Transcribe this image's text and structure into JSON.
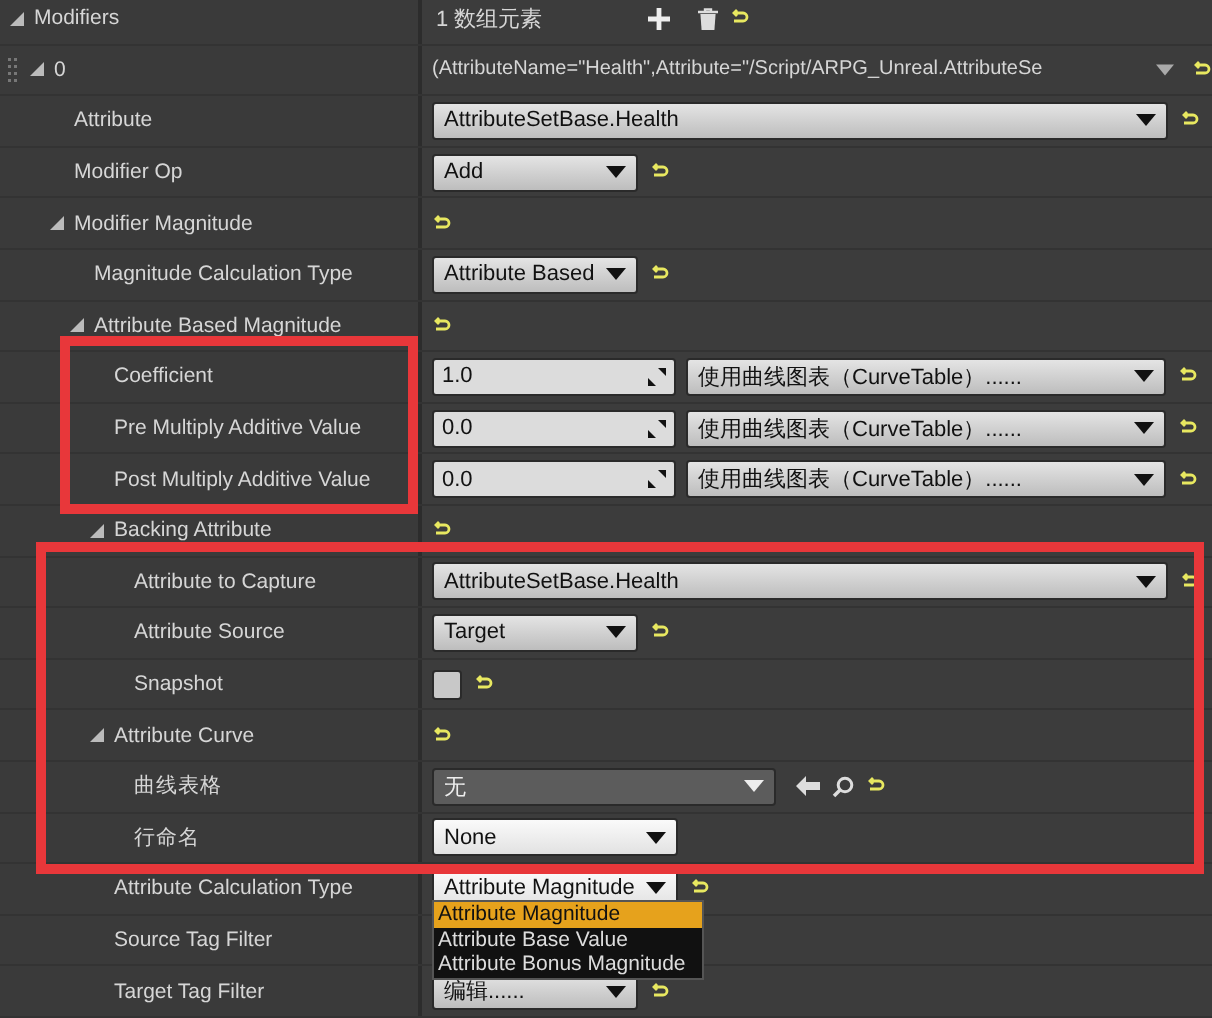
{
  "rows": [
    {
      "label": "Modifiers",
      "expanded": true,
      "reset": true,
      "value": {
        "kind": "count",
        "text": "1 数组元素"
      },
      "children": [
        {
          "label": "0",
          "expanded": true,
          "reset": true,
          "value": {
            "kind": "struct",
            "text": "(AttributeName=\"Health\",Attribute=\"/Script/ARPG_Unreal.AttributeSe"
          },
          "children": [
            {
              "label": "Attribute",
              "reset": true,
              "value": {
                "kind": "combo-wide",
                "text": "AttributeSetBase.Health"
              }
            },
            {
              "label": "Modifier Op",
              "reset": true,
              "value": {
                "kind": "combo",
                "text": "Add"
              }
            },
            {
              "label": "Modifier Magnitude",
              "expanded": true,
              "reset": true,
              "value": {
                "kind": "none"
              },
              "children": [
                {
                  "label": "Magnitude Calculation Type",
                  "reset": true,
                  "value": {
                    "kind": "combo",
                    "text": "Attribute Based"
                  }
                },
                {
                  "label": "Attribute Based Magnitude",
                  "expanded": true,
                  "reset": true,
                  "value": {
                    "kind": "none"
                  },
                  "children": [
                    {
                      "label": "Coefficient",
                      "reset": true,
                      "label_highlighted": true,
                      "value": {
                        "kind": "number-curve",
                        "text": "1.0",
                        "curve": "使用曲线图表（CurveTable）......"
                      }
                    },
                    {
                      "label": "Pre Multiply Additive Value",
                      "reset": true,
                      "label_highlighted": true,
                      "value": {
                        "kind": "number-curve",
                        "text": "0.0",
                        "curve": "使用曲线图表（CurveTable）......"
                      }
                    },
                    {
                      "label": "Post Multiply Additive Value",
                      "reset": true,
                      "label_highlighted": true,
                      "value": {
                        "kind": "number-curve",
                        "text": "0.0",
                        "curve": "使用曲线图表（CurveTable）......"
                      }
                    },
                    {
                      "label": "Backing Attribute",
                      "expanded": true,
                      "reset": true,
                      "value": {
                        "kind": "none"
                      },
                      "children": [
                        {
                          "label": "Attribute to Capture",
                          "reset": true,
                          "row_highlighted": true,
                          "value": {
                            "kind": "combo-wide",
                            "text": "AttributeSetBase.Health"
                          }
                        },
                        {
                          "label": "Attribute Source",
                          "reset": true,
                          "row_highlighted": true,
                          "value": {
                            "kind": "combo",
                            "text": "Target"
                          }
                        },
                        {
                          "label": "Snapshot",
                          "reset": true,
                          "row_highlighted": true,
                          "value": {
                            "kind": "checkbox",
                            "checked": false
                          }
                        }
                      ]
                    },
                    {
                      "label": "Attribute Curve",
                      "expanded": true,
                      "reset": true,
                      "row_highlighted": true,
                      "value": {
                        "kind": "none"
                      },
                      "children": [
                        {
                          "label": "曲线表格",
                          "reset": true,
                          "row_highlighted": true,
                          "value": {
                            "kind": "asset",
                            "text": "无"
                          }
                        },
                        {
                          "label": "行命名",
                          "row_highlighted": true,
                          "value": {
                            "kind": "combo-light",
                            "text": "None"
                          }
                        }
                      ]
                    },
                    {
                      "label": "Attribute Calculation Type",
                      "reset": true,
                      "value": {
                        "kind": "combo-light",
                        "text": "Attribute Magnitude",
                        "options": [
                          {
                            "label": "Attribute Magnitude",
                            "selected": true
                          },
                          {
                            "label": "Attribute Base Value",
                            "selected": false
                          },
                          {
                            "label": "Attribute Bonus Magnitude",
                            "selected": false
                          }
                        ]
                      }
                    },
                    {
                      "label": "Source Tag Filter",
                      "value": {
                        "kind": "none"
                      }
                    },
                    {
                      "label": "Target Tag Filter",
                      "reset": true,
                      "value": {
                        "kind": "combo",
                        "text": "编辑......"
                      }
                    }
                  ]
                }
              ]
            }
          ]
        }
      ]
    }
  ]
}
